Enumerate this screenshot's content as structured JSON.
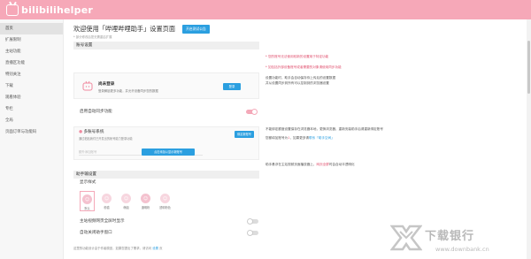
{
  "app": {
    "logo_text": "bilibilihelper"
  },
  "sidebar": {
    "items": [
      {
        "label": "首页",
        "active": true
      },
      {
        "label": "扩展限制"
      },
      {
        "label": "主站功能"
      },
      {
        "label": "直播区功能"
      },
      {
        "label": "特别关注"
      },
      {
        "label": "下载"
      },
      {
        "label": "观看体验"
      },
      {
        "label": "专栏"
      },
      {
        "label": "全局"
      },
      {
        "label": "页面订单与功能码"
      }
    ]
  },
  "main": {
    "title": "欢迎使用「哔哩哔哩助手」设置页面",
    "header_button": "开启测试公告",
    "subtitle": "* 部分修改后您无需重启扩展",
    "account_section": "账号设置",
    "login": {
      "title": "尚未登录",
      "desc": "登录解锁更多功能，并允许设备同步您的数据",
      "button": "登录"
    },
    "auto_sync_label": "启用自动同步功能",
    "multi_account": {
      "title": "多账号系统",
      "desc": "通过粘贴我们已开发出的帐号能力登录功能",
      "button": "绑定新账号",
      "input_placeholder": "额外添加账号",
      "confirm_button": "点击添加以显示新账号"
    },
    "helper_section": "助手输设置",
    "display_label": "显示样式",
    "icon_options": [
      {
        "name": "默认",
        "selected": true
      },
      {
        "name": "粉猫"
      },
      {
        "name": "萌姐"
      },
      {
        "name": "通明粉"
      },
      {
        "name": "透明粉色"
      }
    ],
    "float_video_label": "主站视频网页全屏时显示",
    "auto_close_label": "自动关闭助手窗口",
    "note_prefix": "这里的功能设计由于作者原因，如果您提出了需求，请访问",
    "note_link": "设置",
    "note_suffix": "页"
  },
  "right_notes": {
    "red1": "* 您的账号无法使用较新的设置用于特定功能",
    "red2": "* 如包括外部设备账号或者需要的对象请使用同步功能",
    "sync1": "设置功能时，助手会自动保存你上传后的设置数据",
    "sync2": "并从设置同步到所有可以控制到的浏览器设置",
    "multi1": "不能绑定额度设置保存在浏览器本地，更换浏览器，重新安装助手后请重新绑定账号",
    "multi2_prefix": "您都填加账号为",
    "multi2_hl": "1",
    "multi2_mid": "，如果更多请",
    "multi2_link": "联系「助手空间」",
    "display_prefix": "助手悬浮在主站视频页面播放器上，",
    "display_hl": "网页全屏",
    "display_suffix": "时会自动半透明化"
  },
  "watermark": {
    "text": "下载银行",
    "url": "www.downbank.cn"
  }
}
